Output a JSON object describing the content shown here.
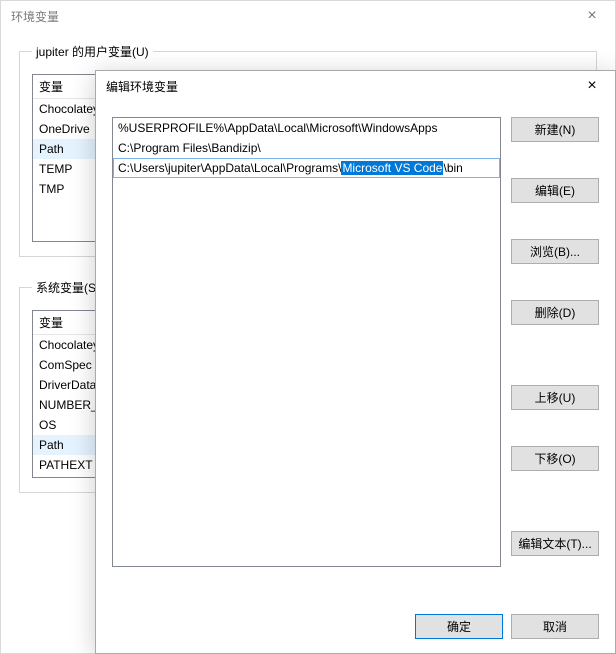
{
  "back": {
    "title": "环境变量",
    "close_glyph": "×",
    "user_group_label": "jupiter 的用户变量(U)",
    "system_group_label": "系统变量(S)",
    "col_variable": "变量",
    "user_vars": [
      {
        "name": "ChocolateyLastPathUpdate"
      },
      {
        "name": "OneDrive"
      },
      {
        "name": "Path"
      },
      {
        "name": "TEMP"
      },
      {
        "name": "TMP"
      }
    ],
    "user_selected_index": 2,
    "system_vars": [
      {
        "name": "ChocolateyInstall"
      },
      {
        "name": "ComSpec"
      },
      {
        "name": "DriverData"
      },
      {
        "name": "NUMBER_OF_PROCESSORS"
      },
      {
        "name": "OS"
      },
      {
        "name": "Path"
      },
      {
        "name": "PATHEXT"
      }
    ],
    "system_selected_index": 5
  },
  "front": {
    "title": "编辑环境变量",
    "close_glyph": "×",
    "paths": [
      {
        "pre": "%USERPROFILE%\\AppData\\Local\\Microsoft\\WindowsApps",
        "hl": "",
        "post": ""
      },
      {
        "pre": "C:\\Program Files\\Bandizip\\",
        "hl": "",
        "post": ""
      },
      {
        "pre": "C:\\Users\\jupiter\\AppData\\Local\\Programs\\",
        "hl": "Microsoft VS Code",
        "post": "\\bin"
      }
    ],
    "selected_index": 2,
    "buttons": {
      "new": "新建(N)",
      "edit": "编辑(E)",
      "browse": "浏览(B)...",
      "delete": "删除(D)",
      "move_up": "上移(U)",
      "move_down": "下移(O)",
      "edit_text": "编辑文本(T)..."
    },
    "ok": "确定",
    "cancel": "取消"
  }
}
